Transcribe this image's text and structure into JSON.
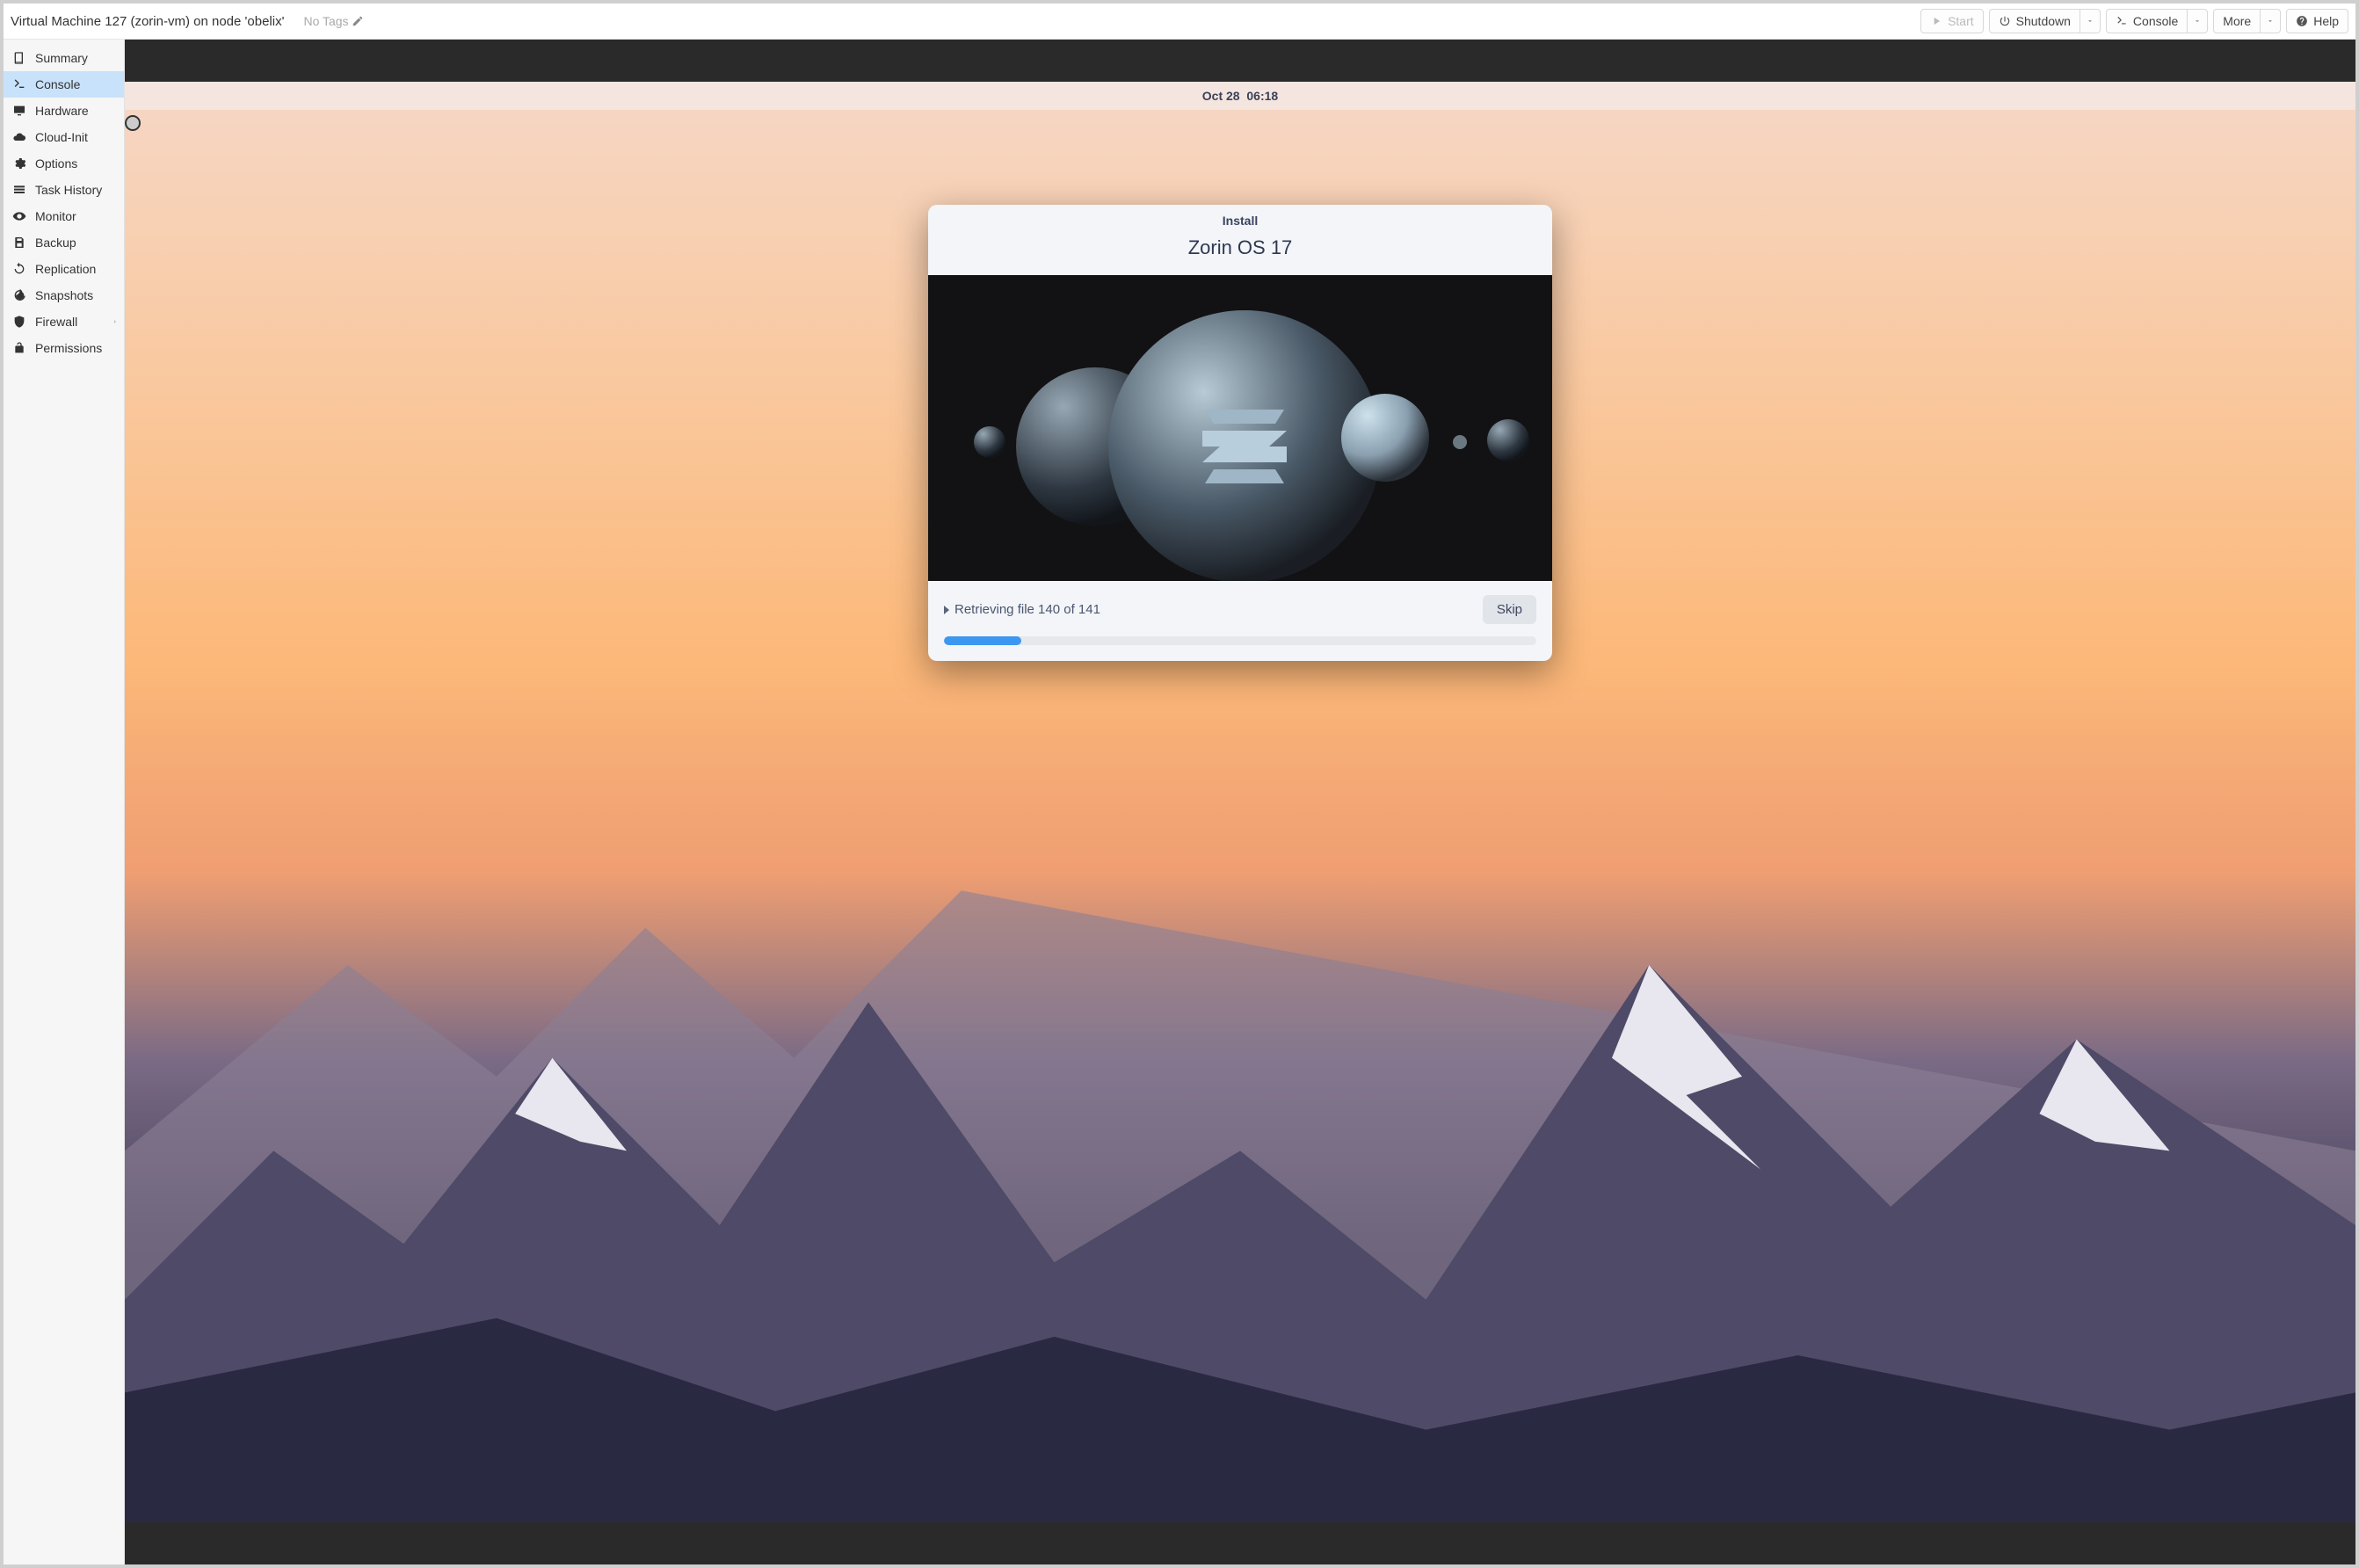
{
  "header": {
    "title": "Virtual Machine 127 (zorin-vm) on node 'obelix'",
    "no_tags": "No Tags",
    "buttons": {
      "start": "Start",
      "shutdown": "Shutdown",
      "console": "Console",
      "more": "More",
      "help": "Help"
    }
  },
  "sidebar": {
    "items": [
      {
        "label": "Summary",
        "icon": "book-icon"
      },
      {
        "label": "Console",
        "icon": "terminal-icon"
      },
      {
        "label": "Hardware",
        "icon": "monitor-icon"
      },
      {
        "label": "Cloud-Init",
        "icon": "cloud-icon"
      },
      {
        "label": "Options",
        "icon": "gear-icon"
      },
      {
        "label": "Task History",
        "icon": "list-icon"
      },
      {
        "label": "Monitor",
        "icon": "eye-icon"
      },
      {
        "label": "Backup",
        "icon": "save-icon"
      },
      {
        "label": "Replication",
        "icon": "sync-icon"
      },
      {
        "label": "Snapshots",
        "icon": "history-icon"
      },
      {
        "label": "Firewall",
        "icon": "shield-icon"
      },
      {
        "label": "Permissions",
        "icon": "unlock-icon"
      }
    ],
    "active_index": 1
  },
  "console": {
    "topbar": {
      "date": "Oct 28",
      "time": "06:18"
    },
    "install": {
      "window_title": "Install",
      "os_title": "Zorin OS 17",
      "status": "Retrieving file 140 of 141",
      "skip_label": "Skip",
      "progress_percent": 13
    }
  }
}
